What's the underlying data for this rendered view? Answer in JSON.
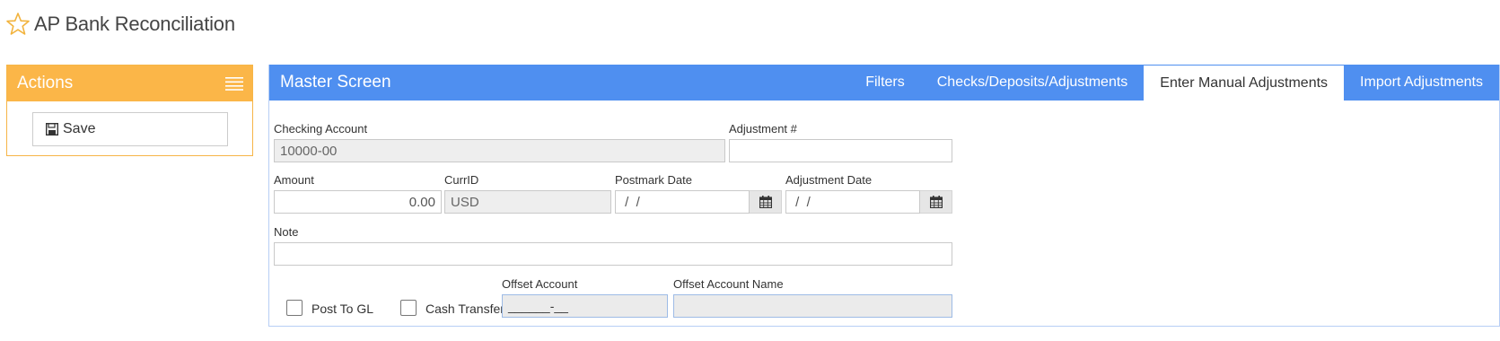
{
  "page": {
    "title": "AP Bank Reconciliation"
  },
  "actions": {
    "title": "Actions",
    "save_label": "Save"
  },
  "master": {
    "title": "Master Screen",
    "tabs": [
      {
        "label": "Filters",
        "active": false
      },
      {
        "label": "Checks/Deposits/Adjustments",
        "active": false
      },
      {
        "label": "Enter Manual Adjustments",
        "active": true
      },
      {
        "label": "Import Adjustments",
        "active": false
      }
    ]
  },
  "form": {
    "checking_account": {
      "label": "Checking Account",
      "value": "10000-00"
    },
    "adjustment_no": {
      "label": "Adjustment #",
      "value": ""
    },
    "amount": {
      "label": "Amount",
      "value": "0.00"
    },
    "curr_id": {
      "label": "CurrID",
      "value": "USD"
    },
    "postmark_date": {
      "label": "Postmark Date",
      "value": " /  /"
    },
    "adjustment_date": {
      "label": "Adjustment Date",
      "value": " /  /"
    },
    "note": {
      "label": "Note",
      "value": ""
    },
    "post_to_gl": {
      "label": "Post To GL",
      "checked": false
    },
    "cash_transfer": {
      "label": "Cash Transfer",
      "checked": false
    },
    "offset_account": {
      "label": "Offset Account",
      "value": "______-__"
    },
    "offset_account_name": {
      "label": "Offset Account Name",
      "value": ""
    }
  },
  "colors": {
    "actions_header": "#fbb648",
    "master_header": "#4f8ff0",
    "star": "#f2b33d"
  },
  "icons": {
    "favorite": "star-icon",
    "menu": "hamburger-menu-icon",
    "save": "floppy-disk-icon",
    "calendar": "calendar-icon"
  }
}
